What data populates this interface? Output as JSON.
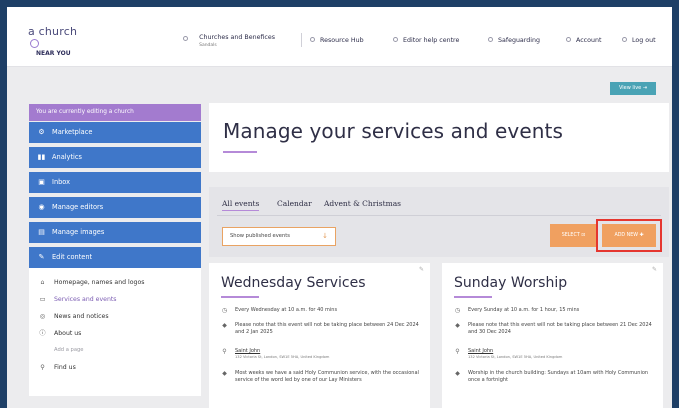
{
  "app": {
    "logo_line1": "a church",
    "logo_line2": "NEAR YOU"
  },
  "header": {
    "church_name": "Churches and Benefices",
    "church_sub": "Sandals",
    "nav": [
      {
        "label": "Resource Hub",
        "icon": "resource-hub-icon"
      },
      {
        "label": "Editor help centre",
        "icon": "help-icon"
      },
      {
        "label": "Safeguarding",
        "icon": "safeguarding-icon"
      },
      {
        "label": "Account",
        "icon": "account-icon"
      },
      {
        "label": "Log out",
        "icon": "logout-icon"
      }
    ]
  },
  "view_live_label": "View live",
  "sidebar": {
    "editing_banner": "You are currently editing a church",
    "items": [
      {
        "label": "Marketplace",
        "icon": "marketplace-icon"
      },
      {
        "label": "Analytics",
        "icon": "analytics-icon"
      },
      {
        "label": "Inbox",
        "icon": "inbox-icon"
      },
      {
        "label": "Manage editors",
        "icon": "editors-icon"
      },
      {
        "label": "Manage images",
        "icon": "images-icon"
      },
      {
        "label": "Edit content",
        "icon": "pencil-icon"
      }
    ],
    "sub_items": [
      {
        "label": "Homepage, names and logos",
        "icon": "home-icon"
      },
      {
        "label": "Services and events",
        "icon": "calendar-icon"
      },
      {
        "label": "News and notices",
        "icon": "news-icon"
      },
      {
        "label": "About us",
        "icon": "info-icon"
      },
      {
        "label": "Add a page",
        "icon": ""
      },
      {
        "label": "Find us",
        "icon": "map-pin-icon"
      }
    ]
  },
  "main": {
    "title": "Manage your services and events",
    "tabs": [
      "All events",
      "Calendar",
      "Advent & Christmas"
    ],
    "filter_label": "Show published events",
    "select_label": "SELECT",
    "add_new_label": "ADD NEW"
  },
  "cards": [
    {
      "title": "Wednesday Services",
      "schedule": "Every Wednesday at 10 a.m. for 40 mins",
      "note": "Please note that this event will not be taking place between 24 Dec 2024 and 2 Jan 2025",
      "location": "Saint John",
      "address": "132 Victoria St, London, SW1E 5HA, United Kingdom",
      "description": "Most weeks we have a said Holy Communion service, with the occasional service of the word led by one of our Lay Ministers"
    },
    {
      "title": "Sunday Worship",
      "schedule": "Every Sunday at 10 a.m. for 1 hour, 15 mins",
      "note": "Please note that this event will not be taking place between 21 Dec 2024 and 30 Dec 2024",
      "location": "Saint John",
      "address": "132 Victoria St, London, SW1E 5HA, United Kingdom",
      "description": "Worship in the church building: Sundays at 10am with Holy Communion once a fortnight"
    }
  ]
}
